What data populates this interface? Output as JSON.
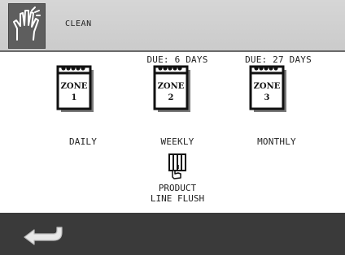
{
  "header": {
    "title": "CLEAN",
    "icon": "hand-wash-icon"
  },
  "zones": [
    {
      "label_top": "ZONE",
      "number": "1",
      "due": "",
      "frequency": "DAILY",
      "icon": "calendar-icon"
    },
    {
      "label_top": "ZONE",
      "number": "2",
      "due": "DUE: 6 DAYS",
      "frequency": "WEEKLY",
      "icon": "calendar-icon"
    },
    {
      "label_top": "ZONE",
      "number": "3",
      "due": "DUE: 27 DAYS",
      "frequency": "MONTHLY",
      "icon": "calendar-icon"
    }
  ],
  "product_flush": {
    "line1": "PRODUCT",
    "line2": "LINE FLUSH",
    "icon": "flush-hand-icon"
  },
  "footer": {
    "back_icon": "back-arrow-icon"
  },
  "colors": {
    "header_bg": "#d0d0d0",
    "footer_bg": "#3a3a3a",
    "icon_box": "#5e5e5e"
  }
}
